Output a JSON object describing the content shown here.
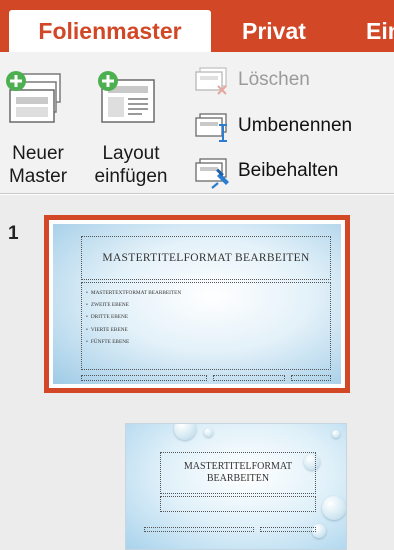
{
  "tabs": [
    {
      "label": "Folienmaster",
      "active": true
    },
    {
      "label": "Privat",
      "active": false
    },
    {
      "label": "Ein",
      "active": false
    }
  ],
  "ribbon": {
    "new_master": {
      "line1": "Neuer",
      "line2": "Master",
      "icon": "new-master-icon"
    },
    "insert_layout": {
      "line1": "Layout",
      "line2": "einfügen",
      "icon": "insert-layout-icon"
    },
    "delete": {
      "label": "Löschen",
      "enabled": false,
      "icon": "delete-layout-icon"
    },
    "rename": {
      "label": "Umbenennen",
      "enabled": true,
      "icon": "rename-icon"
    },
    "preserve": {
      "label": "Beibehalten",
      "enabled": true,
      "icon": "preserve-pin-icon"
    }
  },
  "thumbnails": {
    "master_number": "1",
    "master": {
      "title": "MASTERTITELFORMAT BEARBEITEN",
      "bullets": [
        "MASTERTEXTFORMAT BEARBEITEN",
        "ZWEITE EBENE",
        "DRITTE EBENE",
        "VIERTE EBENE",
        "FÜNFTE EBENE"
      ],
      "selected": true
    },
    "layout1": {
      "title": "MASTERTITELFORMAT BEARBEITEN"
    }
  },
  "colors": {
    "accent": "#d24726",
    "ribbon_bg": "#f2f2f2",
    "pane_bg": "#ececec",
    "icon_green": "#4caf50",
    "icon_blue": "#2b7cd3"
  }
}
